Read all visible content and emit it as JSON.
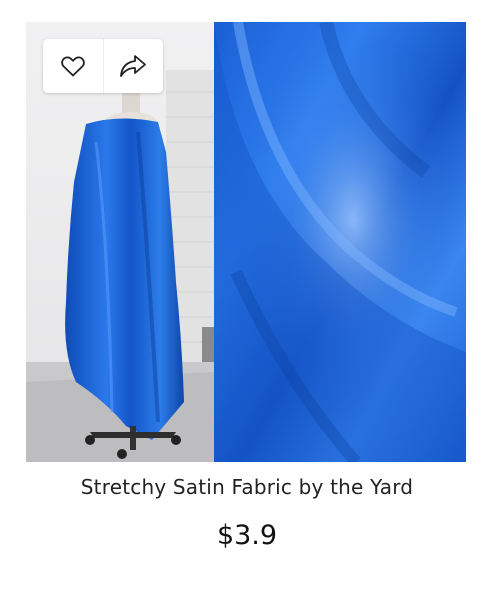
{
  "product": {
    "title": "Stretchy Satin Fabric by the Yard",
    "price": "$3.9",
    "fabric_color": "#1d63d6"
  },
  "actions": {
    "favorite_icon": "heart-icon",
    "share_icon": "share-icon"
  },
  "colors": {
    "icon_stroke": "#222222",
    "background": "#ffffff"
  }
}
